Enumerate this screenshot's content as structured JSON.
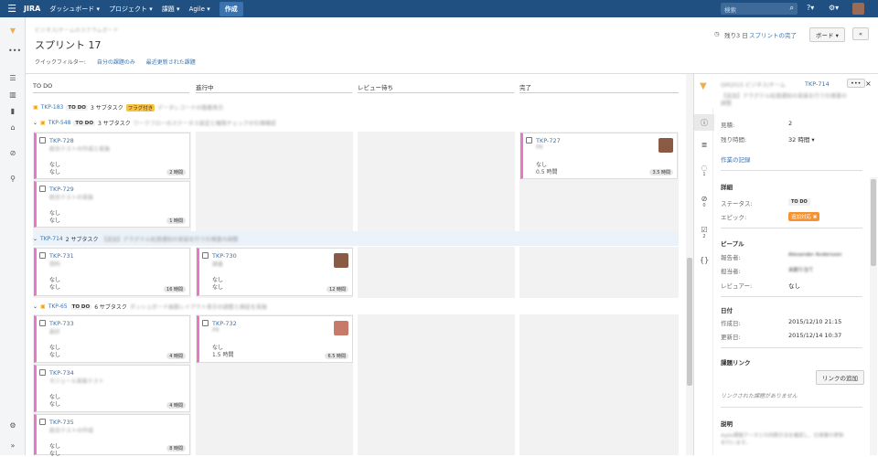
{
  "topbar": {
    "logo": "JIRA",
    "nav": [
      "ダッシュボード ▾",
      "プロジェクト ▾",
      "課題 ▾",
      "Agile ▾"
    ],
    "create": "作成",
    "search_placeholder": "検索"
  },
  "header": {
    "breadcrumb": "ビジネス/チームのスクラムボード",
    "title": "スプリント 17",
    "quick_filter_label": "クイックフィルター:",
    "quick_filters": [
      "自分の課題のみ",
      "最近更新された課題"
    ],
    "days_left": "残り3 日",
    "complete_sprint": "スプリントの完了",
    "board_button": "ボード ▾",
    "collapse": "«"
  },
  "columns": [
    "TO DO",
    "進行中",
    "レビュー待ち",
    "完了"
  ],
  "lanes": [
    {
      "key": "TKP-183",
      "status": "TO DO",
      "subtasks": "3 サブタスク",
      "flag": "フラグ付き",
      "summary": "データレコードの階層表示"
    },
    {
      "key": "TKP-548",
      "status": "TO DO",
      "subtasks": "3 サブタスク",
      "summary": "ワークフローのステータス設定と権限チェックの仕様確認"
    },
    {
      "key": "TKP-714",
      "status": "",
      "subtasks": "2 サブタスク",
      "summary": "【追加】アラグテル処理通知の実装を行う仕様書の調整"
    },
    {
      "key": "TKP-65",
      "status": "TO DO",
      "subtasks": "6 サブタスク",
      "summary": "ダッシュボード画面レイアウト表示の調整と検証を実施"
    }
  ],
  "cards": [
    {
      "key": "TKP-728",
      "summary": "統合テストの作成と実施",
      "l1": "なし",
      "l2": "なし",
      "est": "2 時間"
    },
    {
      "key": "TKP-729",
      "summary": "統合テストの実装",
      "l1": "なし",
      "l2": "なし",
      "est": "1 時間"
    },
    {
      "key": "TKP-727",
      "summary": "PR",
      "l1": "なし",
      "l2": "0.5 時間",
      "est": "3.5 時間"
    },
    {
      "key": "TKP-731",
      "summary": "資料",
      "l1": "なし",
      "l2": "なし",
      "est": "16 時間"
    },
    {
      "key": "TKP-730",
      "summary": "調査",
      "l1": "なし",
      "l2": "なし",
      "est": "12 時間"
    },
    {
      "key": "TKP-733",
      "summary": "設計",
      "l1": "なし",
      "l2": "なし",
      "est": "4 時間"
    },
    {
      "key": "TKP-732",
      "summary": "PR",
      "l1": "なし",
      "l2": "1.5 時間",
      "est": "6.5 時間"
    },
    {
      "key": "TKP-734",
      "summary": "モジュール実装テスト",
      "l1": "なし",
      "l2": "なし",
      "est": "4 時間"
    },
    {
      "key": "TKP-735",
      "summary": "統合テストの作成",
      "l1": "なし",
      "l2": "なし",
      "est": "8 時間"
    }
  ],
  "panel": {
    "breadcrumb": "GM2015 ビジネス/チーム",
    "key": "TKP-714",
    "summary": "【追加】アラグテル処理通知の実装を行う仕様書の調整",
    "estimate_label": "見積:",
    "estimate_value": "2",
    "remaining_label": "残り時間:",
    "remaining_value": "32 時間 ▾",
    "log_work": "作業の記録",
    "details_title": "詳細",
    "status_label": "ステータス:",
    "status_value": "TO DO",
    "epic_label": "エピック:",
    "epic_value": "追加対応 ✖",
    "people_title": "ピープル",
    "reporter_label": "報告者:",
    "reporter_value": "Alexander Andersson",
    "assignee_label": "担当者:",
    "assignee_value": "未割り当て",
    "reviewer_label": "レビュアー:",
    "reviewer_value": "なし",
    "dates_title": "日付",
    "created_label": "作成日:",
    "created_value": "2015/12/10 21:15",
    "updated_label": "更新日:",
    "updated_value": "2015/12/14 10:37",
    "links_title": "課題リンク",
    "add_link": "リンクの追加",
    "no_links": "リンクされた課題がありません",
    "description_title": "説明",
    "description": "Agile課題データとの同期方法を確認し、仕様書の更新を行います。"
  },
  "tab_counts": {
    "comments": "1",
    "attachments": "0",
    "subtasks": "2"
  }
}
